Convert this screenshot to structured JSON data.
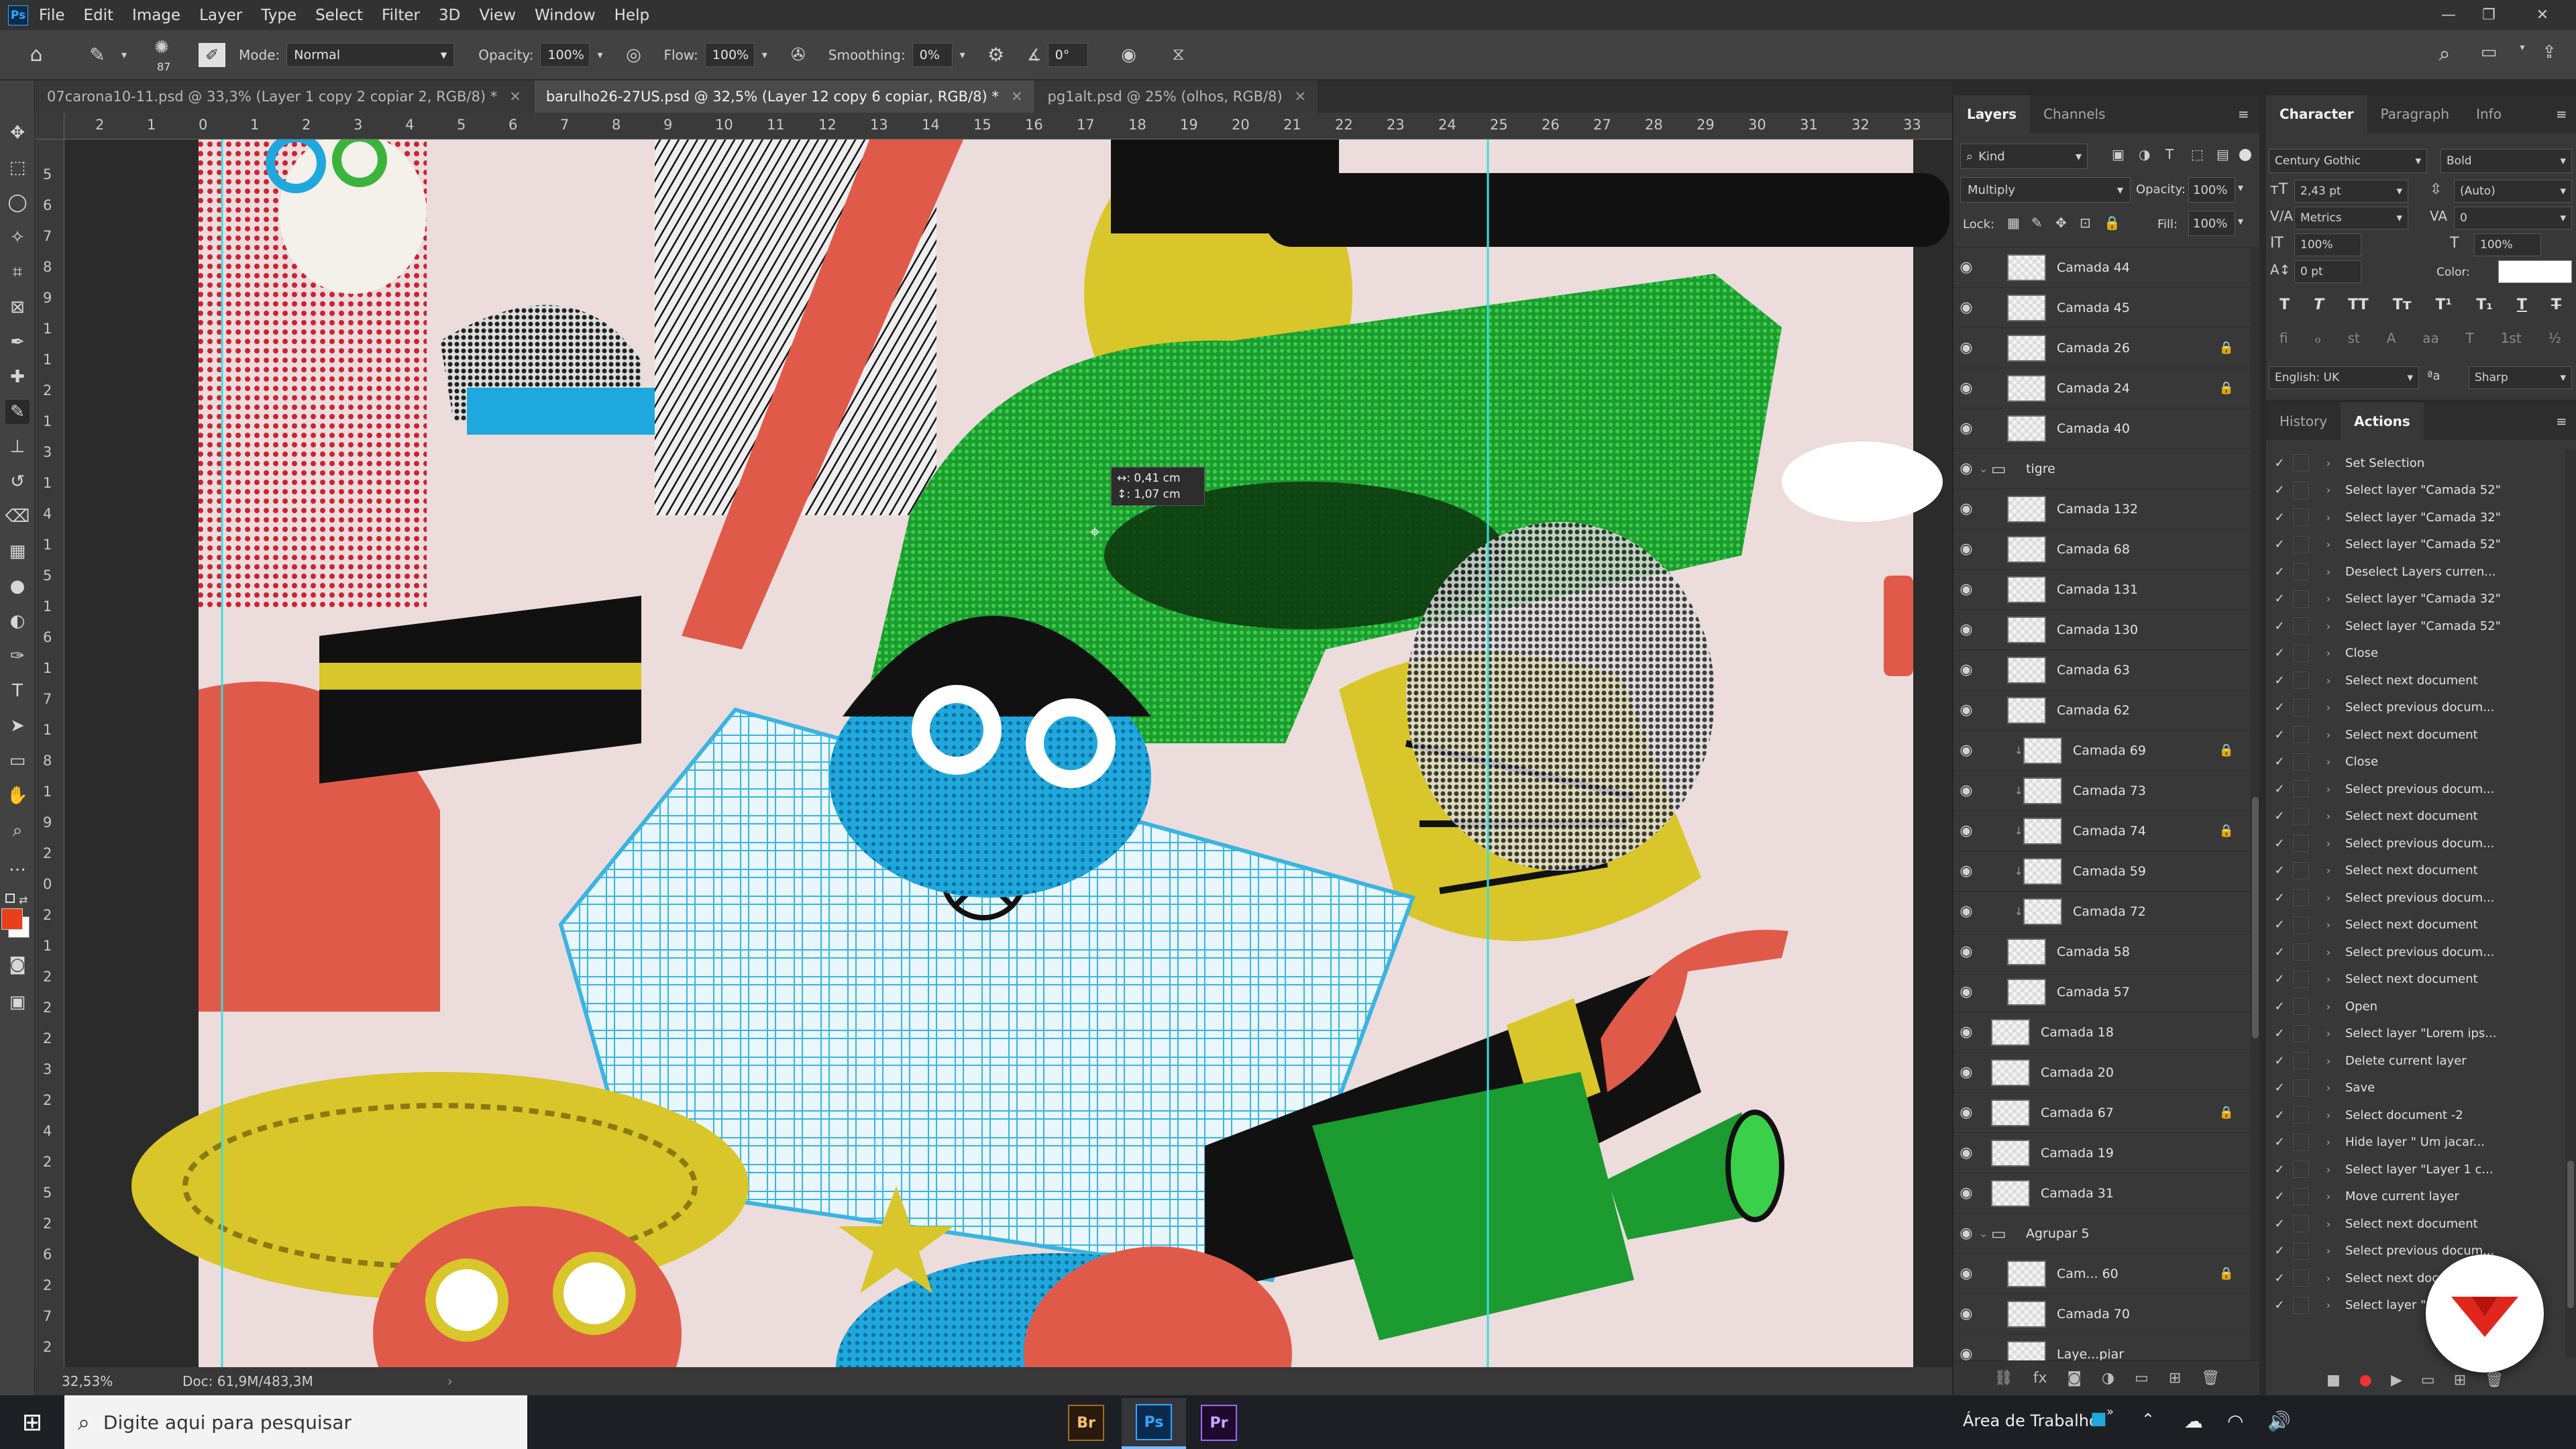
{
  "app": {
    "logo": "Ps",
    "menu": [
      "File",
      "Edit",
      "Image",
      "Layer",
      "Type",
      "Select",
      "Filter",
      "3D",
      "View",
      "Window",
      "Help"
    ]
  },
  "options": {
    "brush_size": "87",
    "mode_label": "Mode:",
    "mode": "Normal",
    "opacity_label": "Opacity:",
    "opacity": "100%",
    "flow_label": "Flow:",
    "flow": "100%",
    "smoothing_label": "Smoothing:",
    "smoothing": "0%",
    "angle": "0°"
  },
  "tabs": [
    {
      "label": "07carona10-11.psd @ 33,3% (Layer 1 copy 2 copiar 2, RGB/8) *",
      "active": false
    },
    {
      "label": "barulho26-27US.psd @ 32,5% (Layer 12 copy 6 copiar, RGB/8) *",
      "active": true
    },
    {
      "label": "pg1alt.psd @ 25% (olhos, RGB/8)",
      "active": false
    }
  ],
  "ruler_top": [
    "2",
    "1",
    "0",
    "1",
    "2",
    "3",
    "4",
    "5",
    "6",
    "7",
    "8",
    "9",
    "10",
    "11",
    "12",
    "13",
    "14",
    "15",
    "16",
    "17",
    "18",
    "19",
    "20",
    "21",
    "22",
    "23",
    "24",
    "25",
    "26",
    "27",
    "28",
    "29",
    "30",
    "31",
    "32",
    "33"
  ],
  "ruler_left": [
    "5",
    "6",
    "7",
    "8",
    "9",
    "1",
    "1",
    "2",
    "1",
    "3",
    "1",
    "4",
    "1",
    "5",
    "1",
    "6",
    "1",
    "7",
    "1",
    "8",
    "1",
    "9",
    "2",
    "0",
    "2",
    "1",
    "2",
    "2",
    "2",
    "3",
    "2",
    "4",
    "2",
    "5",
    "2",
    "6",
    "2",
    "7",
    "2"
  ],
  "canvas": {
    "measure_w": "↔: 0,41 cm",
    "measure_h": "↕: 1,07 cm"
  },
  "status": {
    "zoom": "32,53%",
    "doc": "Doc: 61,9M/483,3M"
  },
  "layers_panel": {
    "tabs": [
      "Layers",
      "Channels"
    ],
    "filter": "Kind",
    "blend": "Multiply",
    "opacity_label": "Opacity:",
    "opacity": "100%",
    "lock_label": "Lock:",
    "fill_label": "Fill:",
    "fill": "100%",
    "rows": [
      {
        "name": "Camada 44",
        "indent": 1,
        "lock": ""
      },
      {
        "name": "Camada 45",
        "indent": 1,
        "lock": ""
      },
      {
        "name": "Camada 26",
        "indent": 1,
        "lock": "🔒"
      },
      {
        "name": "Camada 24",
        "indent": 1,
        "lock": "🔒"
      },
      {
        "name": "Camada 40",
        "indent": 1,
        "lock": ""
      },
      {
        "name": "tigre",
        "indent": 0,
        "lock": "",
        "group": true
      },
      {
        "name": "Camada 132",
        "indent": 1,
        "lock": ""
      },
      {
        "name": "Camada 68",
        "indent": 1,
        "lock": ""
      },
      {
        "name": "Camada 131",
        "indent": 1,
        "lock": ""
      },
      {
        "name": "Camada 130",
        "indent": 1,
        "lock": ""
      },
      {
        "name": "Camada 63",
        "indent": 1,
        "lock": ""
      },
      {
        "name": "Camada 62",
        "indent": 1,
        "lock": ""
      },
      {
        "name": "Camada 69",
        "indent": 2,
        "lock": "🔒"
      },
      {
        "name": "Camada 73",
        "indent": 2,
        "lock": ""
      },
      {
        "name": "Camada 74",
        "indent": 2,
        "lock": "🔒"
      },
      {
        "name": "Camada 59",
        "indent": 2,
        "lock": ""
      },
      {
        "name": "Camada 72",
        "indent": 2,
        "lock": ""
      },
      {
        "name": "Camada 58",
        "indent": 1,
        "lock": ""
      },
      {
        "name": "Camada 57",
        "indent": 1,
        "lock": ""
      },
      {
        "name": "Camada 18",
        "indent": 0,
        "lock": ""
      },
      {
        "name": "Camada 20",
        "indent": 0,
        "lock": ""
      },
      {
        "name": "Camada 67",
        "indent": 0,
        "lock": "🔒"
      },
      {
        "name": "Camada 19",
        "indent": 0,
        "lock": ""
      },
      {
        "name": "Camada 31",
        "indent": 0,
        "lock": ""
      },
      {
        "name": "Agrupar 5",
        "indent": 0,
        "lock": "",
        "group": true
      },
      {
        "name": "Cam... 60",
        "indent": 1,
        "lock": "🔒"
      },
      {
        "name": "Camada 70",
        "indent": 1,
        "lock": ""
      },
      {
        "name": "Laye...piar",
        "indent": 1,
        "lock": ""
      }
    ]
  },
  "character_panel": {
    "tabs": [
      "Character",
      "Paragraph",
      "Info"
    ],
    "font": "Century Gothic",
    "style": "Bold",
    "size": "2,43 pt",
    "leading": "(Auto)",
    "kerning": "Metrics",
    "tracking": "0",
    "vscale": "100%",
    "hscale": "100%",
    "baseline": "0 pt",
    "color_label": "Color:",
    "language": "English: UK",
    "aa": "Sharp"
  },
  "actions_panel": {
    "tabs": [
      "History",
      "Actions"
    ],
    "rows": [
      "Set Selection",
      "Select layer \"Camada 52\"",
      "Select layer \"Camada 32\"",
      "Select layer \"Camada 52\"",
      "Deselect Layers curren...",
      "Select layer \"Camada 32\"",
      "Select layer \"Camada 52\"",
      "Close",
      "Select next document",
      "Select previous docum...",
      "Select next document",
      "Close",
      "Select previous docum...",
      "Select next document",
      "Select previous docum...",
      "Select next document",
      "Select previous docum...",
      "Select next document",
      "Select previous docum...",
      "Select next document",
      "Open",
      "Select layer \"Lorem ips...",
      "Delete current layer",
      "Save",
      "Select document -2",
      "Hide layer \" Um jacar...",
      "Select layer \"Layer 1 c...",
      "Move current layer",
      "Select next document",
      "Select previous docum...",
      "Select next document",
      "Select layer \"Camada 52\""
    ]
  },
  "taskbar": {
    "search": "Digite aqui para pesquisar",
    "apps": [
      "Br",
      "Ps",
      "Pr"
    ],
    "desktop": "Área de Trabalho"
  },
  "colors": {
    "accent": "#31a8ff",
    "fg_swatch": "#e8401c",
    "bg_swatch": "#ffffff"
  }
}
